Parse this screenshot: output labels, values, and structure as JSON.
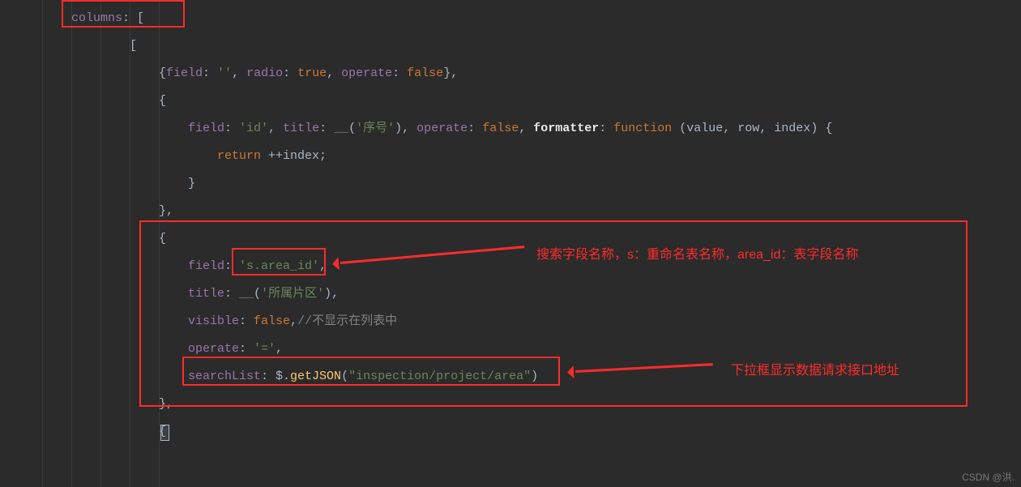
{
  "code": {
    "l1": {
      "a": "columns",
      "b": ": ["
    },
    "l2": {
      "a": "["
    },
    "l3": {
      "a": "{",
      "b": "field",
      "c": ": ",
      "d": "''",
      "e": ", ",
      "f": "radio",
      "g": ": ",
      "h": "true",
      "i": ", ",
      "j": "operate",
      "k": ": ",
      "l": "false",
      "m": "},"
    },
    "l4": {
      "a": "{"
    },
    "l5": {
      "a": "field",
      "b": ": ",
      "c": "'id'",
      "d": ", ",
      "e": "title",
      "f": ": ",
      "g": "__",
      "h": "(",
      "i": "'序号'",
      "j": "), ",
      "k": "operate",
      "l": ": ",
      "m": "false",
      "n": ", ",
      "o": "formatter",
      "p": ": ",
      "q": "function",
      "r": " (",
      "s": "value, row, index",
      "t": ") {"
    },
    "l6": {
      "a": "return",
      "b": " ++index;"
    },
    "l7": {
      "a": "}"
    },
    "l8": {
      "a": "},"
    },
    "l9": {
      "a": "{"
    },
    "l10": {
      "a": "field",
      "b": ": ",
      "c": "'s.area_id'",
      "d": ","
    },
    "l11": {
      "a": "title",
      "b": ": ",
      "c": "__",
      "d": "(",
      "e": "'所属片区'",
      "f": "),"
    },
    "l12": {
      "a": "visible",
      "b": ": ",
      "c": "false",
      "d": ",",
      "e": "//不显示在列表中"
    },
    "l13": {
      "a": "operate",
      "b": ": ",
      "c": "'='",
      "d": ","
    },
    "l14": {
      "a": "searchList",
      "b": ": ",
      "c": "$.",
      "d": "getJSON",
      "e": "(",
      "f": "\"inspection/project/area\"",
      "g": ")"
    },
    "l15": {
      "a": "},"
    },
    "l16": {
      "a": "{"
    }
  },
  "annotations": {
    "field": "搜索字段名称，s：重命名表名称，area_id：表字段名称",
    "searchlist": "下拉框显示数据请求接口地址"
  },
  "watermark": "CSDN @洪."
}
